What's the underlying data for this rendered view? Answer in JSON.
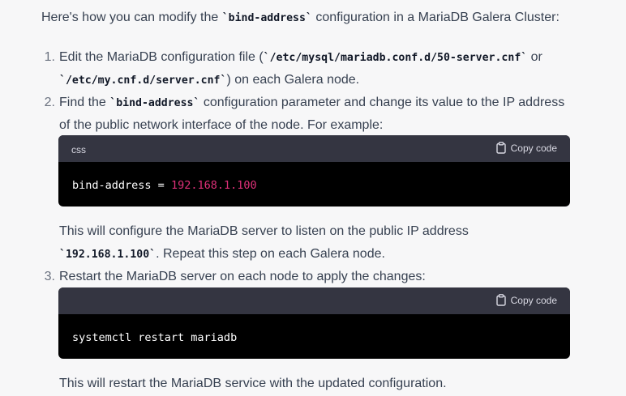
{
  "intro": {
    "before": "Here's how you can modify the ",
    "code": "`bind-address`",
    "after": " configuration in a MariaDB Galera Cluster:"
  },
  "steps": [
    {
      "number": "1.",
      "line1_before": "Edit the MariaDB configuration file (",
      "line1_code": "`/etc/mysql/mariadb.conf.d/50-server.cnf`",
      "line1_after": " or",
      "line2_code": "`/etc/my.cnf.d/server.cnf`",
      "line2_after": ") on each Galera node."
    },
    {
      "number": "2.",
      "line1_before": "Find the ",
      "line1_code": "`bind-address`",
      "line1_after": " configuration parameter and change its value to the IP address",
      "line2": "of the public network interface of the node. For example:"
    },
    {
      "number": "3.",
      "line1": "Restart the MariaDB server on each node to apply the changes:"
    }
  ],
  "codeblock1": {
    "language": "css",
    "copy_label": "Copy code",
    "key": "bind-address",
    "operator": " = ",
    "value_a": "192.168",
    "value_b": ".1",
    "value_c": ".100"
  },
  "after_code1": {
    "line1": "This will configure the MariaDB server to listen on the public IP address",
    "line2_code": "`192.168.1.100`",
    "line2_after": ". Repeat this step on each Galera node."
  },
  "codeblock2": {
    "language": "",
    "copy_label": "Copy code",
    "code": "systemctl restart mariadb"
  },
  "closing": "This will restart the MariaDB service with the updated configuration.",
  "colors": {
    "background": "#f7f7f8",
    "text": "#374151",
    "code_bg": "#000000",
    "code_header_bg": "#343541",
    "number_token": "#df3079"
  },
  "icons": {
    "copy": "clipboard-icon"
  }
}
